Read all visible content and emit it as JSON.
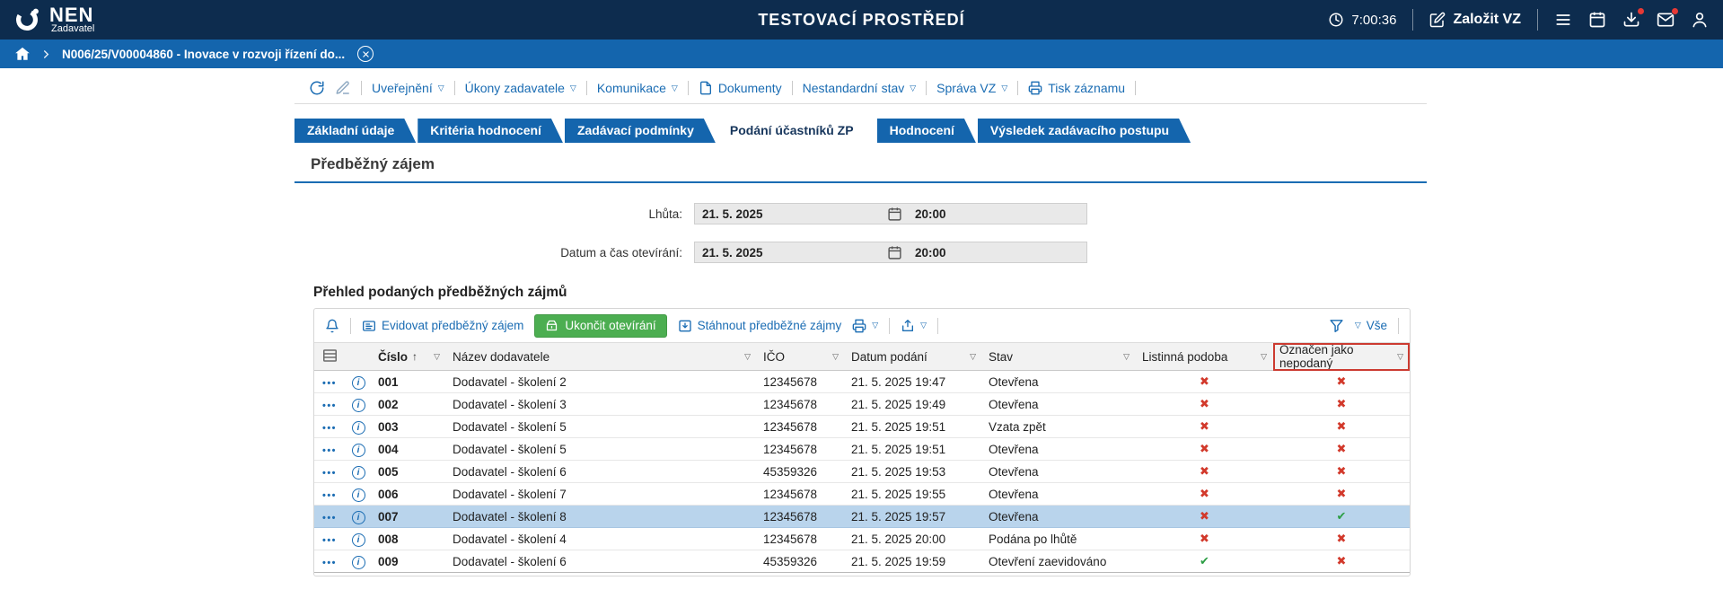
{
  "colors": {
    "header_bg": "#0d2c4e",
    "breadcrumb_bg": "#1465ad",
    "accent_blue": "#1a6cb3",
    "tab_blue": "#1465ad",
    "button_green": "#4cae51",
    "cross_red": "#d2392b",
    "check_green": "#2c9e45",
    "selected_row": "#b9d4ec",
    "highlight_red_box": "#cc3b31"
  },
  "header": {
    "logo": "NEN",
    "role": "Zadavatel",
    "env_title": "TESTOVACÍ PROSTŘEDÍ",
    "time": "7:00:36",
    "create_vz": "Založit VZ"
  },
  "breadcrumb": {
    "item": "N006/25/V00004860 - Inovace v rozvoji řízení do..."
  },
  "menu": {
    "items": [
      {
        "label": "Uveřejnění",
        "dropdown": true,
        "icon": ""
      },
      {
        "label": "Úkony zadavatele",
        "dropdown": true,
        "icon": ""
      },
      {
        "label": "Komunikace",
        "dropdown": true,
        "icon": ""
      },
      {
        "label": "Dokumenty",
        "dropdown": false,
        "icon": "document"
      },
      {
        "label": "Nestandardní stav",
        "dropdown": true,
        "icon": ""
      },
      {
        "label": "Správa VZ",
        "dropdown": true,
        "icon": ""
      },
      {
        "label": "Tisk záznamu",
        "dropdown": false,
        "icon": "printer"
      }
    ]
  },
  "tabs": [
    {
      "label": "Základní údaje",
      "active": false
    },
    {
      "label": "Kritéria hodnocení",
      "active": false
    },
    {
      "label": "Zadávací podmínky",
      "active": false
    },
    {
      "label": "Podání účastníků ZP",
      "active": true
    },
    {
      "label": "Hodnocení",
      "active": false
    },
    {
      "label": "Výsledek zadávacího postupu",
      "active": false
    }
  ],
  "section_title": "Předběžný zájem",
  "fields": [
    {
      "label": "Lhůta:",
      "date": "21. 5. 2025",
      "time": "20:00"
    },
    {
      "label": "Datum a čas otevírání:",
      "date": "21. 5. 2025",
      "time": "20:00"
    }
  ],
  "list": {
    "title": "Přehled podaných předběžných zájmů",
    "toolbar": {
      "evidovat": "Evidovat předběžný zájem",
      "ukoncit": "Ukončit otevírání",
      "stahnout": "Stáhnout předběžné zájmy",
      "vse": "Vše"
    },
    "columns": [
      {
        "label": "Číslo",
        "sorted": true,
        "highlighted": false
      },
      {
        "label": "Název dodavatele",
        "sorted": false,
        "highlighted": false
      },
      {
        "label": "IČO",
        "sorted": false,
        "highlighted": false
      },
      {
        "label": "Datum podání",
        "sorted": false,
        "highlighted": false
      },
      {
        "label": "Stav",
        "sorted": false,
        "highlighted": false
      },
      {
        "label": "Listinná podoba",
        "sorted": false,
        "highlighted": false
      },
      {
        "label": "Označen jako nepodaný",
        "sorted": false,
        "highlighted": true
      }
    ],
    "rows": [
      {
        "number": "001",
        "supplier": "Dodavatel - školení 2",
        "ico": "12345678",
        "submitted": "21. 5. 2025 19:47",
        "status": "Otevřena",
        "paper_form": false,
        "marked_not_submitted": false,
        "selected": false
      },
      {
        "number": "002",
        "supplier": "Dodavatel - školení 3",
        "ico": "12345678",
        "submitted": "21. 5. 2025 19:49",
        "status": "Otevřena",
        "paper_form": false,
        "marked_not_submitted": false,
        "selected": false
      },
      {
        "number": "003",
        "supplier": "Dodavatel - školení 5",
        "ico": "12345678",
        "submitted": "21. 5. 2025 19:51",
        "status": "Vzata zpět",
        "paper_form": false,
        "marked_not_submitted": false,
        "selected": false
      },
      {
        "number": "004",
        "supplier": "Dodavatel - školení 5",
        "ico": "12345678",
        "submitted": "21. 5. 2025 19:51",
        "status": "Otevřena",
        "paper_form": false,
        "marked_not_submitted": false,
        "selected": false
      },
      {
        "number": "005",
        "supplier": "Dodavatel - školení 6",
        "ico": "45359326",
        "submitted": "21. 5. 2025 19:53",
        "status": "Otevřena",
        "paper_form": false,
        "marked_not_submitted": false,
        "selected": false
      },
      {
        "number": "006",
        "supplier": "Dodavatel - školení 7",
        "ico": "12345678",
        "submitted": "21. 5. 2025 19:55",
        "status": "Otevřena",
        "paper_form": false,
        "marked_not_submitted": false,
        "selected": false
      },
      {
        "number": "007",
        "supplier": "Dodavatel - školení 8",
        "ico": "12345678",
        "submitted": "21. 5. 2025 19:57",
        "status": "Otevřena",
        "paper_form": false,
        "marked_not_submitted": true,
        "selected": true
      },
      {
        "number": "008",
        "supplier": "Dodavatel - školení 4",
        "ico": "12345678",
        "submitted": "21. 5. 2025 20:00",
        "status": "Podána po lhůtě",
        "paper_form": false,
        "marked_not_submitted": false,
        "selected": false
      },
      {
        "number": "009",
        "supplier": "Dodavatel - školení 6",
        "ico": "45359326",
        "submitted": "21. 5. 2025 19:59",
        "status": "Otevření zaevidováno",
        "paper_form": true,
        "marked_not_submitted": false,
        "selected": false
      }
    ]
  }
}
